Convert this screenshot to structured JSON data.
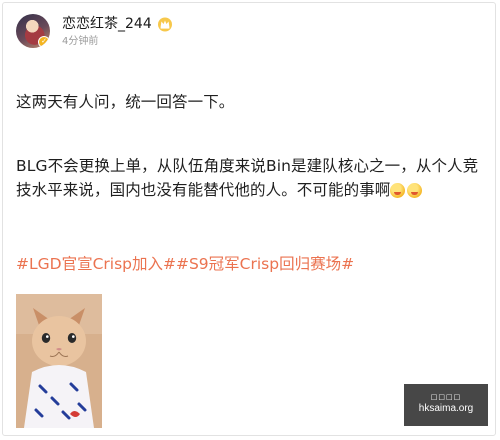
{
  "post": {
    "author": {
      "name": "恋恋红茶_244",
      "badge_icon": "vip-crown-icon",
      "verified_icon": "verified-badge-icon"
    },
    "timestamp": "4分钟前",
    "paragraphs": [
      "这两天有人问，统一回答一下。",
      "BLG不会更换上单，从队伍角度来说Bin是建队核心之一，从个人竞技水平来说，国内也没有能替代他的人。不可能的事啊"
    ],
    "emojis": [
      "laughing-emoji-icon",
      "laughing-emoji-icon"
    ],
    "hashtags": [
      "#LGD官宣Crisp加入#",
      "#S9冠军Crisp回归赛场#"
    ],
    "image": {
      "subject": "cat-photo"
    }
  },
  "watermark": {
    "line1": "□□□□",
    "line2": "hksaima.org"
  },
  "colors": {
    "hashtag": "#eb7350",
    "text": "#1f1f1f",
    "timestamp": "#9a9a9a",
    "watermark_bg": "#2d2d2d"
  }
}
